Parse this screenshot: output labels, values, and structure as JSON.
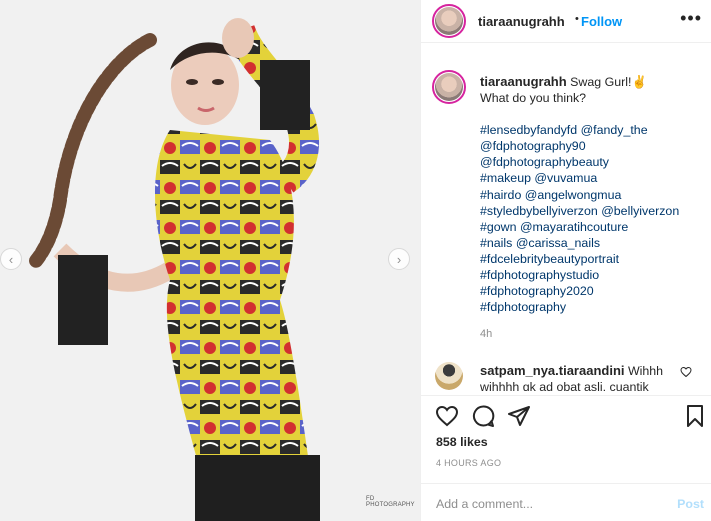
{
  "post": {
    "username": "tiaraanugrahh",
    "follow_label": "Follow",
    "follow_dot": "•",
    "more_label": "•••",
    "caption_text": "Swag Gurl!",
    "caption_emoji": "✌",
    "caption_line2": "What do you think?",
    "hashtags": [
      "#lensedbyfandyfd @fandy_the",
      "@fdphotography90",
      "@fdphotographybeauty",
      "#makeup @vuvamua",
      "#hairdo @angelwongmua",
      "#styledbybellyiverzon @bellyiverzon",
      "#gown @mayaratihcouture",
      "#nails @carissa_nails",
      "#fdcelebritybeautyportrait",
      "#fdphotographystudio",
      "#fdphotography2020",
      "#fdphotography"
    ],
    "caption_age": "4h",
    "comment": {
      "username": "satpam_nya.tiaraandini",
      "text": "Wihhh wihhhh gk ad obat asli, cuantik"
    },
    "likes": "858 likes",
    "time_ago": "4 HOURS AGO",
    "add_comment_placeholder": "Add a comment...",
    "post_label": "Post",
    "watermark": "FD PHOTOGRAPHY"
  },
  "icons": {
    "heart": "heart-icon",
    "comment": "comment-icon",
    "share": "share-icon",
    "bookmark": "bookmark-icon",
    "prev": "chevron-left-icon",
    "next": "chevron-right-icon"
  },
  "colors": {
    "accent": "#0095f6",
    "hashtag": "#00376b",
    "muted": "#8e8e8e",
    "post_disabled": "#b2dffc"
  }
}
